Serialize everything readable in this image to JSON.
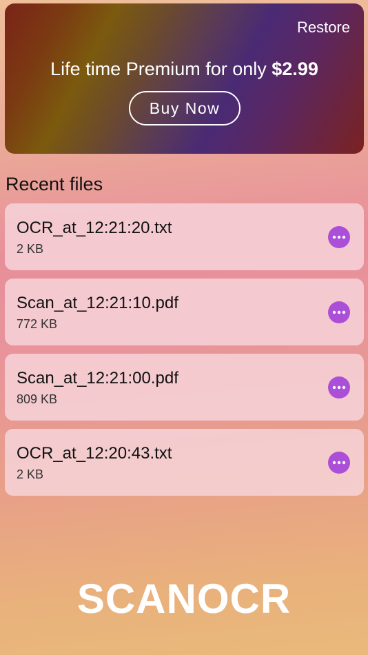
{
  "promo": {
    "restore_label": "Restore",
    "text": "Life time Premium for only ",
    "price": "$2.99",
    "buy_label": "Buy Now"
  },
  "recent": {
    "title": "Recent files",
    "files": [
      {
        "name": "OCR_at_12:21:20.txt",
        "size": "2 KB"
      },
      {
        "name": "Scan_at_12:21:10.pdf",
        "size": "772 KB"
      },
      {
        "name": "Scan_at_12:21:00.pdf",
        "size": "809 KB"
      },
      {
        "name": "OCR_at_12:20:43.txt",
        "size": "2 KB"
      }
    ],
    "more_icon": "ellipsis-icon"
  },
  "brand": {
    "name": "SCANOCR"
  },
  "colors": {
    "accent": "#ab4fd8",
    "promo_start": "#7a2418",
    "promo_mid": "#4a2a74"
  }
}
